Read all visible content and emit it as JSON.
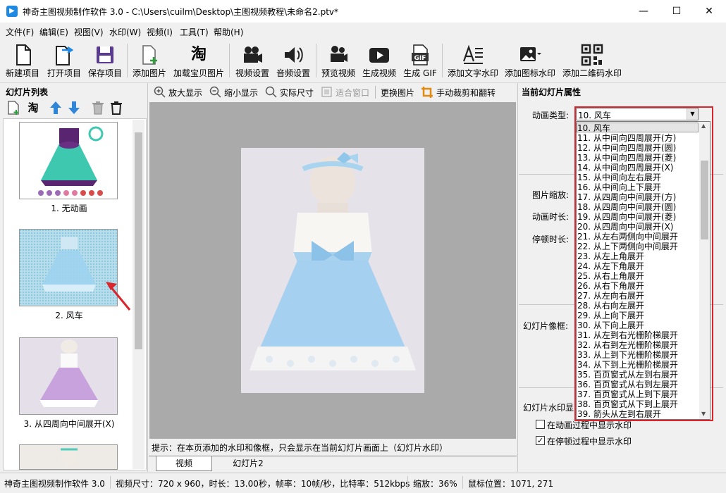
{
  "window": {
    "title": "神奇主图视频制作软件 3.0 - C:\\Users\\cuilm\\Desktop\\主图视频教程\\未命名2.ptv*",
    "minimize": "—",
    "maximize": "☐",
    "close": "✕"
  },
  "menu": [
    "文件(F)",
    "编辑(E)",
    "视图(V)",
    "水印(W)",
    "视频(I)",
    "工具(T)",
    "帮助(H)"
  ],
  "toolbar": {
    "new_project": "新建项目",
    "open_project": "打开项目",
    "save_project": "保存项目",
    "add_image": "添加图片",
    "load_taobao": "加载宝贝图片",
    "video_settings": "视频设置",
    "audio_settings": "音频设置",
    "preview_video": "预览视频",
    "generate_video": "生成视频",
    "generate_gif": "生成 GIF",
    "add_text_watermark": "添加文字水印",
    "add_icon_watermark": "添加图标水印",
    "add_qr_watermark": "添加二维码水印",
    "taobao_glyph": "淘",
    "gif_glyph": "GIF"
  },
  "left_panel": {
    "header": "幻灯片列表",
    "taobao_glyph": "淘",
    "slides": [
      {
        "caption": "1. 无动画"
      },
      {
        "caption": "2. 风车"
      },
      {
        "caption": "3. 从四周向中间展开(X)"
      }
    ]
  },
  "center_toolbar": {
    "zoom_in": "放大显示",
    "zoom_out": "缩小显示",
    "actual_size": "实际尺寸",
    "fit_window": "适合窗口",
    "replace_image": "更换图片",
    "crop_flip": "手动裁剪和翻转"
  },
  "hint": "提示：在本页添加的水印和像框，只会显示在当前幻灯片画面上（幻灯片水印）",
  "tabs": [
    "视频",
    "幻灯片2"
  ],
  "right_panel": {
    "header": "当前幻灯片属性",
    "anim_type_label": "动画类型:",
    "anim_type_value": "10. 风车",
    "image_scale_label": "图片缩放:",
    "anim_duration_label": "动画时长:",
    "pause_duration_label": "停顿时长:",
    "frame_label": "幻灯片像框:",
    "watermark_label": "幻灯片水印显",
    "show_in_anim": "在动画过程中显示水印",
    "show_in_pause": "在停顿过程中显示水印",
    "show_in_anim_checked": false,
    "show_in_pause_checked": true
  },
  "dropdown_options": [
    "10. 风车",
    "11. 从中间向四周展开(方)",
    "12. 从中间向四周展开(圆)",
    "13. 从中间向四周展开(菱)",
    "14. 从中间向四周展开(X)",
    "15. 从中间向左右展开",
    "16. 从中间向上下展开",
    "17. 从四周向中间展开(方)",
    "18. 从四周向中间展开(圆)",
    "19. 从四周向中间展开(菱)",
    "20. 从四周向中间展开(X)",
    "21. 从左右两侧向中间展开",
    "22. 从上下两侧向中间展开",
    "23. 从左上角展开",
    "24. 从左下角展开",
    "25. 从右上角展开",
    "26. 从右下角展开",
    "27. 从左向右展开",
    "28. 从右向左展开",
    "29. 从上向下展开",
    "30. 从下向上展开",
    "31. 从左到右光栅阶梯展开",
    "32. 从右到左光栅阶梯展开",
    "33. 从上到下光栅阶梯展开",
    "34. 从下到上光栅阶梯展开",
    "35. 百页窗式从左到右展开",
    "36. 百页窗式从右到左展开",
    "37. 百页窗式从上到下展开",
    "38. 百页窗式从下到上展开",
    "39. 箭头从左到右展开"
  ],
  "status": {
    "app": "神奇主图视频制作软件 3.0",
    "info": "视频尺寸：720 x 960，时长：13.00秒，帧率：10帧/秒，比特率：512kbps",
    "zoom": "缩放：36%",
    "mouse": "鼠标位置：1071, 271"
  },
  "colors": {
    "accent": "#1e88e5",
    "highlight": "#d9262c",
    "canvas_bg": "#aaaaaa"
  }
}
